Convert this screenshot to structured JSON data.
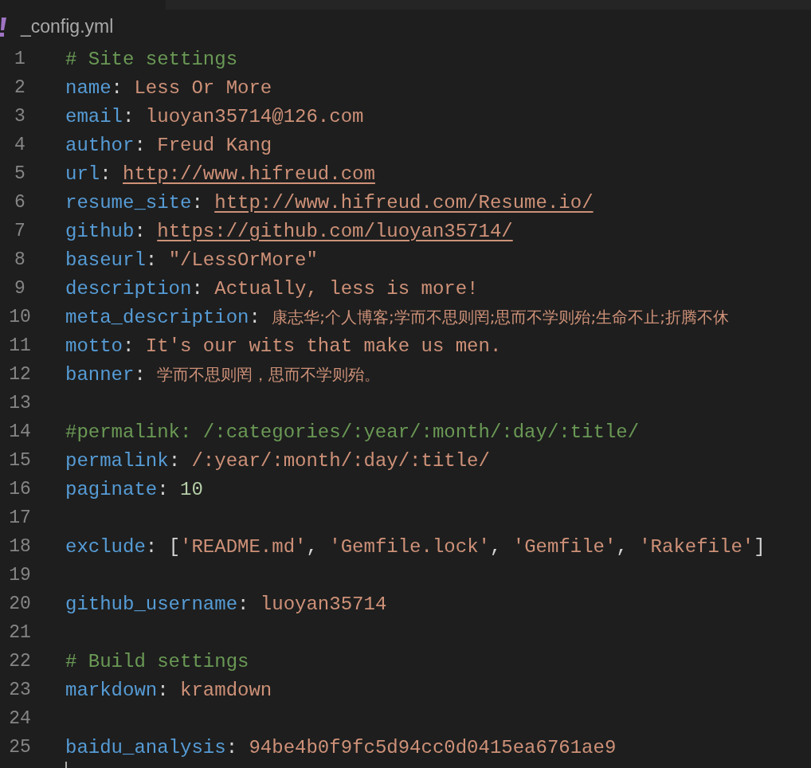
{
  "tab": {
    "title": "_config.yml"
  },
  "lines": [
    {
      "number": "1",
      "tokens": [
        {
          "kind": "comment",
          "text": "# Site settings"
        }
      ]
    },
    {
      "number": "2",
      "tokens": [
        {
          "kind": "key",
          "text": "name"
        },
        {
          "kind": "punct",
          "text": ": "
        },
        {
          "kind": "string",
          "text": "Less Or More"
        }
      ]
    },
    {
      "number": "3",
      "tokens": [
        {
          "kind": "key",
          "text": "email"
        },
        {
          "kind": "punct",
          "text": ": "
        },
        {
          "kind": "string",
          "text": "luoyan35714@126.com"
        }
      ]
    },
    {
      "number": "4",
      "tokens": [
        {
          "kind": "key",
          "text": "author"
        },
        {
          "kind": "punct",
          "text": ": "
        },
        {
          "kind": "string",
          "text": "Freud Kang"
        }
      ]
    },
    {
      "number": "5",
      "tokens": [
        {
          "kind": "key",
          "text": "url"
        },
        {
          "kind": "punct",
          "text": ": "
        },
        {
          "kind": "link",
          "text": "http://www.hifreud.com"
        }
      ]
    },
    {
      "number": "6",
      "tokens": [
        {
          "kind": "key",
          "text": "resume_site"
        },
        {
          "kind": "punct",
          "text": ": "
        },
        {
          "kind": "link",
          "text": "http://www.hifreud.com/Resume.io/"
        }
      ]
    },
    {
      "number": "7",
      "tokens": [
        {
          "kind": "key",
          "text": "github"
        },
        {
          "kind": "punct",
          "text": ": "
        },
        {
          "kind": "link",
          "text": "https://github.com/luoyan35714/"
        }
      ]
    },
    {
      "number": "8",
      "tokens": [
        {
          "kind": "key",
          "text": "baseurl"
        },
        {
          "kind": "punct",
          "text": ": "
        },
        {
          "kind": "string",
          "text": "\"/LessOrMore\""
        }
      ]
    },
    {
      "number": "9",
      "tokens": [
        {
          "kind": "key",
          "text": "description"
        },
        {
          "kind": "punct",
          "text": ": "
        },
        {
          "kind": "string",
          "text": "Actually, less is more!"
        }
      ]
    },
    {
      "number": "10",
      "tokens": [
        {
          "kind": "key",
          "text": "meta_description"
        },
        {
          "kind": "punct",
          "text": ": "
        },
        {
          "kind": "prose",
          "text": "康志华;个人博客;学而不思则罔;思而不学则殆;生命不止;折腾不休"
        }
      ]
    },
    {
      "number": "11",
      "tokens": [
        {
          "kind": "key",
          "text": "motto"
        },
        {
          "kind": "punct",
          "text": ": "
        },
        {
          "kind": "string",
          "text": "It's our wits that make us men."
        }
      ]
    },
    {
      "number": "12",
      "tokens": [
        {
          "kind": "key",
          "text": "banner"
        },
        {
          "kind": "punct",
          "text": ": "
        },
        {
          "kind": "prose",
          "text": "学而不思则罔，思而不学则殆。"
        }
      ]
    },
    {
      "number": "13"
    },
    {
      "number": "14",
      "tokens": [
        {
          "kind": "comment",
          "text": "#permalink: /:categories/:year/:month/:day/:title/"
        }
      ]
    },
    {
      "number": "15",
      "tokens": [
        {
          "kind": "key",
          "text": "permalink"
        },
        {
          "kind": "punct",
          "text": ": "
        },
        {
          "kind": "string",
          "text": "/:year/:month/:day/:title/"
        }
      ]
    },
    {
      "number": "16",
      "tokens": [
        {
          "kind": "key",
          "text": "paginate"
        },
        {
          "kind": "punct",
          "text": ": "
        },
        {
          "kind": "number",
          "text": "10"
        }
      ]
    },
    {
      "number": "17"
    },
    {
      "number": "18",
      "tokens": [
        {
          "kind": "key",
          "text": "exclude"
        },
        {
          "kind": "punct",
          "text": ": ["
        },
        {
          "kind": "string",
          "text": "'README.md'"
        },
        {
          "kind": "punct",
          "text": ", "
        },
        {
          "kind": "string",
          "text": "'Gemfile.lock'"
        },
        {
          "kind": "punct",
          "text": ", "
        },
        {
          "kind": "string",
          "text": "'Gemfile'"
        },
        {
          "kind": "punct",
          "text": ", "
        },
        {
          "kind": "string",
          "text": "'Rakefile'"
        },
        {
          "kind": "punct",
          "text": "]"
        }
      ]
    },
    {
      "number": "19"
    },
    {
      "number": "20",
      "tokens": [
        {
          "kind": "key",
          "text": "github_username"
        },
        {
          "kind": "punct",
          "text": ": "
        },
        {
          "kind": "string",
          "text": "luoyan35714"
        }
      ]
    },
    {
      "number": "21"
    },
    {
      "number": "22",
      "tokens": [
        {
          "kind": "comment",
          "text": "# Build settings"
        }
      ]
    },
    {
      "number": "23",
      "tokens": [
        {
          "kind": "key",
          "text": "markdown"
        },
        {
          "kind": "punct",
          "text": ": "
        },
        {
          "kind": "string",
          "text": "kramdown"
        }
      ]
    },
    {
      "number": "24"
    },
    {
      "number": "25",
      "tokens": [
        {
          "kind": "key",
          "text": "baidu_analysis"
        },
        {
          "kind": "punct",
          "text": ": "
        },
        {
          "kind": "string",
          "text": "94be4b0f9fc5d94cc0d0415ea6761ae9"
        }
      ]
    }
  ]
}
